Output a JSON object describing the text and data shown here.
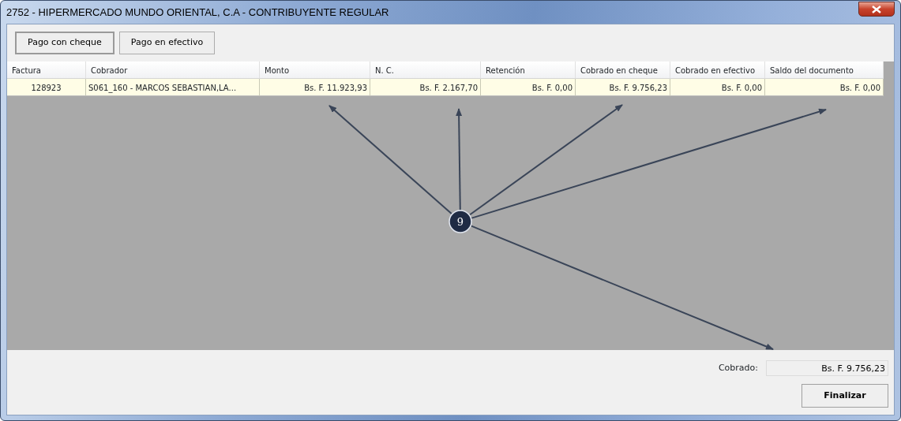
{
  "window": {
    "title": "2752 - HIPERMERCADO MUNDO ORIENTAL, C.A - CONTRIBUYENTE REGULAR"
  },
  "toolbar": {
    "buttons": [
      {
        "label": "Pago con cheque",
        "selected": true
      },
      {
        "label": "Pago en efectivo",
        "selected": false
      }
    ]
  },
  "table": {
    "columns": [
      "Factura",
      "Cobrador",
      "Monto",
      "N. C.",
      "Retención",
      "Cobrado en cheque",
      "Cobrado en efectivo",
      "Saldo del documento"
    ],
    "rows": [
      [
        "128923",
        "S061_160 - MARCOS SEBASTIAN,LA...",
        "Bs. F. 11.923,93",
        "Bs. F. 2.167,70",
        "Bs. F. 0,00",
        "Bs. F. 9.756,23",
        "Bs. F. 0,00",
        "Bs. F. 0,00"
      ]
    ]
  },
  "annotation": {
    "label": "9"
  },
  "footer": {
    "cobrado_label": "Cobrado:",
    "cobrado_value": "Bs. F. 9.756,23",
    "finish_button": "Finalizar"
  }
}
